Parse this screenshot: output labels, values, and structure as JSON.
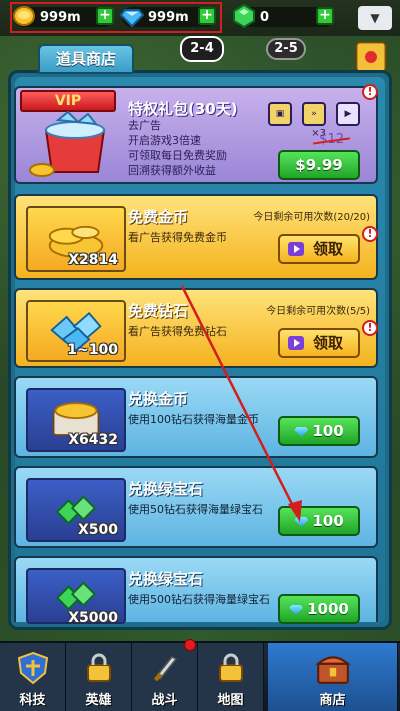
{
  "resources": {
    "gold": "999m",
    "diamond": "999m",
    "emerald": "0",
    "menu_icon": "chevron-down-icon"
  },
  "stages": {
    "current": "2-4",
    "next": "2-5"
  },
  "shop": {
    "tab_label": "道具商店",
    "vip": {
      "badge": "VIP",
      "title": "特权礼包(30天)",
      "desc": [
        "去广告",
        "开启游戏3倍速",
        "可领取每日免费奖励",
        "回溯获得额外收益"
      ],
      "perk_mult": "×3",
      "old_price": "$12",
      "price": "$9.99",
      "alert": "!"
    },
    "items": [
      {
        "title": "免费金币",
        "desc": "看广告获得免费金币",
        "limit": "今日剩余可用次数(20/20)",
        "thumb_label": "X2814",
        "button": "领取",
        "alert": "!"
      },
      {
        "title": "免费钻石",
        "desc": "看广告获得免费钻石",
        "limit": "今日剩余可用次数(5/5)",
        "thumb_label": "1~100",
        "button": "领取",
        "alert": "!"
      },
      {
        "title": "兑换金币",
        "desc": "使用100钻石获得海量金币",
        "thumb_label": "X6432",
        "button": "100"
      },
      {
        "title": "兑换绿宝石",
        "desc": "使用50钻石获得海量绿宝石",
        "thumb_label": "X500",
        "button": "100"
      },
      {
        "title": "兑换绿宝石",
        "desc": "使用500钻石获得海量绿宝石",
        "thumb_label": "X5000",
        "button": "1000"
      }
    ]
  },
  "nav": [
    {
      "label": "科技",
      "icon": "shield-icon"
    },
    {
      "label": "英雄",
      "icon": "lock-icon"
    },
    {
      "label": "战斗",
      "icon": "sword-icon"
    },
    {
      "label": "地图",
      "icon": "lock-icon"
    },
    {
      "label": "商店",
      "icon": "chest-icon"
    }
  ],
  "colors": {
    "annotation": "#d21e1e",
    "panel": "#1f7396",
    "gold_card": "#f4b31e",
    "blue_card": "#5eb4e2",
    "vip_card": "#9b86d7",
    "green_button": "#20a527"
  }
}
